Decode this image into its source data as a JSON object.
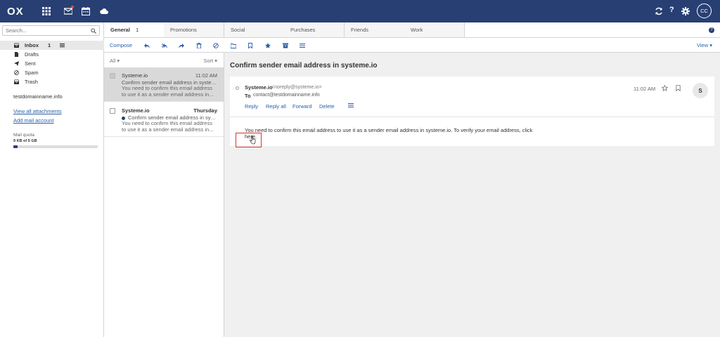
{
  "app": {
    "logo": "OX",
    "user_initials": "CC",
    "help": "?"
  },
  "sidebar": {
    "search_placeholder": "Search...",
    "folders": [
      {
        "label": "Inbox",
        "count": "1"
      },
      {
        "label": "Drafts"
      },
      {
        "label": "Sent"
      },
      {
        "label": "Spam"
      },
      {
        "label": "Trash"
      }
    ],
    "account": "testdomainname.info",
    "view_attachments": "View all attachments",
    "add_account": "Add mail account",
    "quota_label": "Mail quota",
    "quota_value": "9 KB of 5 GB",
    "quota_fraction": 0.05
  },
  "tabs": [
    {
      "label": "General",
      "count": "1"
    },
    {
      "label": "Promotions"
    },
    {
      "label": "Social"
    },
    {
      "label": "Purchases"
    },
    {
      "label": "Friends"
    },
    {
      "label": "Work"
    }
  ],
  "toolbar": {
    "compose": "Compose",
    "view": "View"
  },
  "list": {
    "filter": "All",
    "sort": "Sort",
    "items": [
      {
        "from": "Systeme.io",
        "time": "11:02 AM",
        "subject": "Confirm sender email address in systeme.io",
        "preview": "You need to confirm this email address to use it as a sender email address in..."
      },
      {
        "from": "Systeme.io",
        "time": "Thursday",
        "subject": "Confirm sender email address in systeme.io",
        "preview": "You need to confirm this email address to use it as a sender email address in..."
      }
    ]
  },
  "detail": {
    "subject": "Confirm sender email address in systeme.io",
    "sender_name": "Systeme.io",
    "sender_addr": "<noreply@systeme.io>",
    "to_label": "To",
    "to_addr": "contact@testdomainname.info",
    "time": "11:02 AM",
    "avatar": "S",
    "actions": {
      "reply": "Reply",
      "reply_all": "Reply all",
      "forward": "Forward",
      "delete": "Delete"
    },
    "body": "You need to confirm this email address to use it as a sender email address in systeme.io. To verify your email address, click here."
  },
  "colors": {
    "topbar": "#283f73",
    "link": "#2b5ea8",
    "highlight": "#e03030"
  }
}
